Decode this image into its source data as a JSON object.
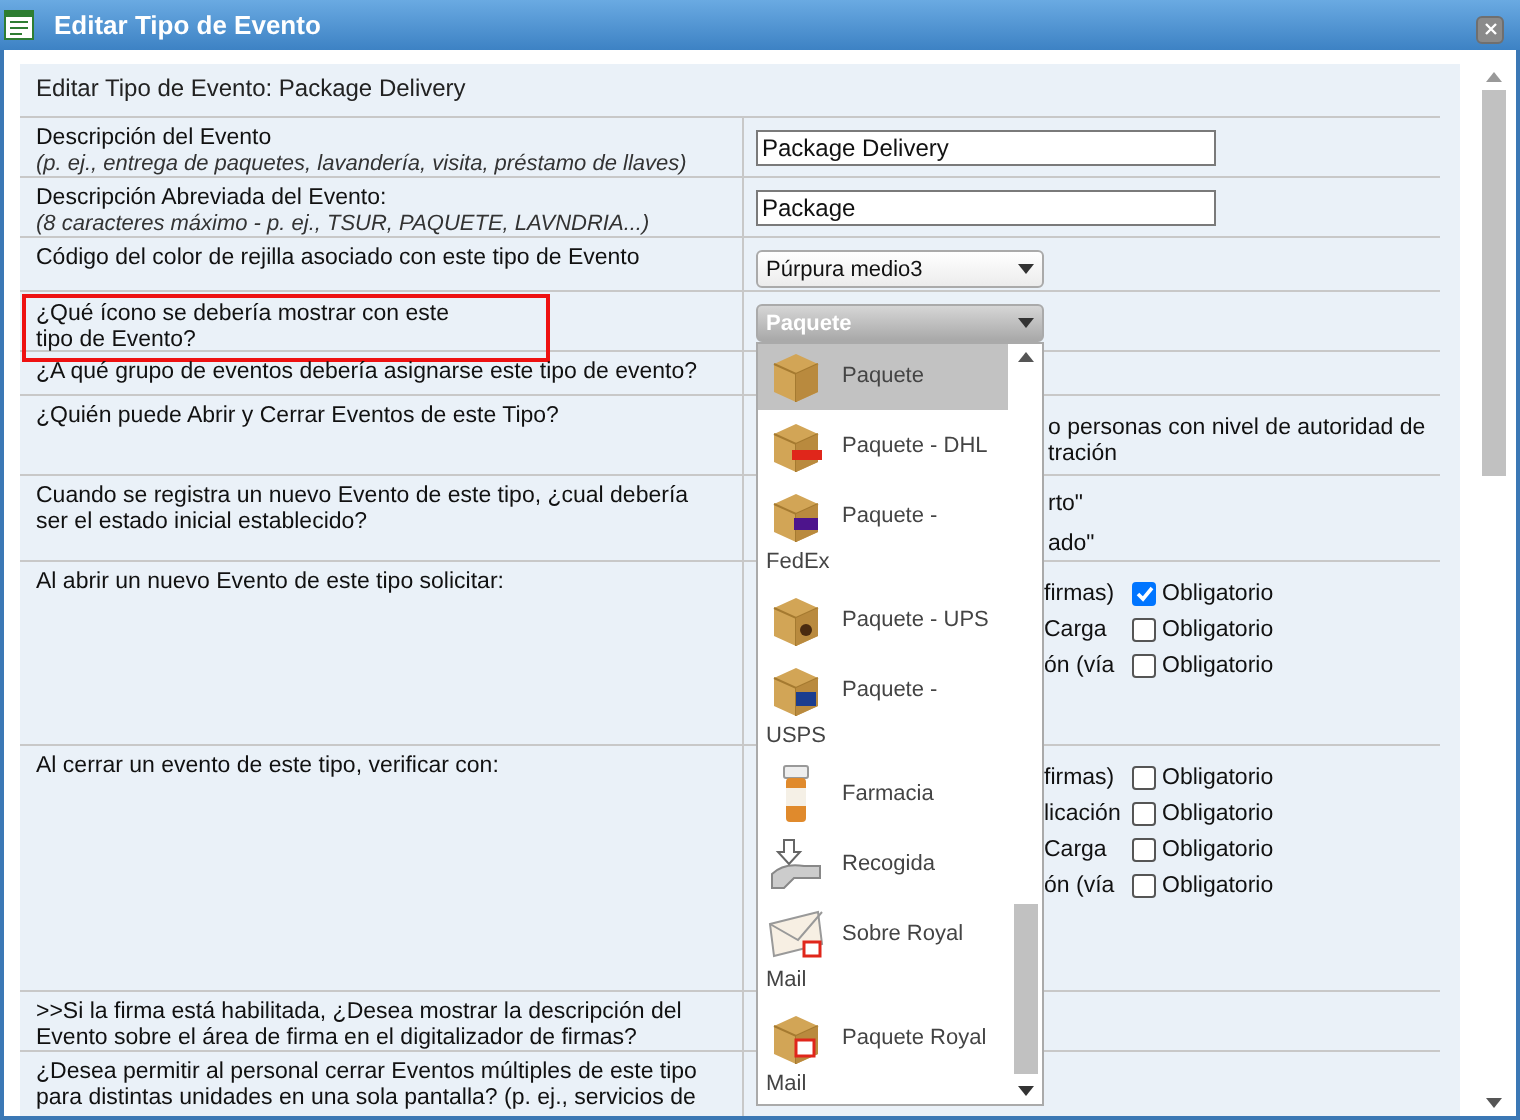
{
  "window": {
    "title": "Editar Tipo de Evento"
  },
  "form": {
    "heading": "Editar Tipo de Evento: Package Delivery",
    "rows": [
      {
        "kind": "input",
        "label": "Descripción del Evento",
        "hint": "(p. ej., entrega de paquetes, lavandería, visita, préstamo de llaves)",
        "value": "Package Delivery"
      },
      {
        "kind": "input",
        "label": "Descripción Abreviada del Evento:",
        "hint": "(8 caracteres máximo - p. ej., TSUR, PAQUETE, LAVNDRIA...)",
        "value": "Package"
      },
      {
        "kind": "select",
        "label": "Código del color de rejilla asociado con este tipo de Evento",
        "value": "Púrpura medio3",
        "open": false,
        "highlighted": false
      },
      {
        "kind": "select",
        "label": "¿Qué ícono se debería mostrar con este\ntipo de Evento?",
        "value": "Paquete",
        "open": true,
        "highlighted": true
      },
      {
        "kind": "plain",
        "label": "¿A qué grupo de eventos debería asignarse este tipo de evento?"
      },
      {
        "kind": "texts",
        "label": "¿Quién puede Abrir y Cerrar Eventos de este Tipo?",
        "texts": [
          "o personas con nivel de autoridad de\ntración"
        ]
      },
      {
        "kind": "texts",
        "label": "Cuando se registra un nuevo Evento de este tipo, ¿cual debería ser el estado inicial establecido?",
        "texts": [
          "rto\"",
          "ado\""
        ]
      },
      {
        "kind": "checks",
        "label": "Al abrir un nuevo Evento de este tipo solicitar:",
        "checks": [
          {
            "text": "firmas)",
            "box_label": "Obligatorio",
            "checked": true
          },
          {
            "text": "Carga",
            "box_label": "Obligatorio",
            "checked": false
          },
          {
            "text": "ón (vía",
            "box_label": "Obligatorio",
            "checked": false
          }
        ]
      },
      {
        "kind": "checks",
        "label": "Al cerrar un evento de este tipo, verificar con:",
        "checks": [
          {
            "text": "firmas)",
            "box_label": "Obligatorio",
            "checked": false
          },
          {
            "text": "licación",
            "box_label": "Obligatorio",
            "checked": false
          },
          {
            "text": "Carga",
            "box_label": "Obligatorio",
            "checked": false
          },
          {
            "text": "ón (vía",
            "box_label": "Obligatorio",
            "checked": false
          }
        ]
      },
      {
        "kind": "plain",
        "label": ">>Si la firma está habilitada, ¿Desea mostrar la descripción del Evento sobre el área de firma en el digitalizador de firmas?"
      },
      {
        "kind": "plain",
        "label": "¿Desea permitir al personal cerrar Eventos múltiples de este tipo para distintas unidades en una sola pantalla? (p. ej., servicios de"
      }
    ]
  },
  "icon_dropdown": {
    "options": [
      {
        "label": "Paquete",
        "kind": "box",
        "selected": true
      },
      {
        "label": "Paquete - DHL",
        "kind": "box-dhl",
        "selected": false
      },
      {
        "label": "Paquete - FedEx",
        "kind": "box-fedex",
        "selected": false
      },
      {
        "label": "Paquete - UPS",
        "kind": "box-ups",
        "selected": false
      },
      {
        "label": "Paquete - USPS",
        "kind": "box-usps",
        "selected": false
      },
      {
        "label": "Farmacia",
        "kind": "bottle",
        "selected": false
      },
      {
        "label": "Recogida",
        "kind": "hand",
        "selected": false
      },
      {
        "label": "Sobre Royal Mail",
        "kind": "envelope",
        "selected": false
      },
      {
        "label": "Paquete Royal Mail",
        "kind": "box-royal",
        "selected": false
      }
    ]
  }
}
